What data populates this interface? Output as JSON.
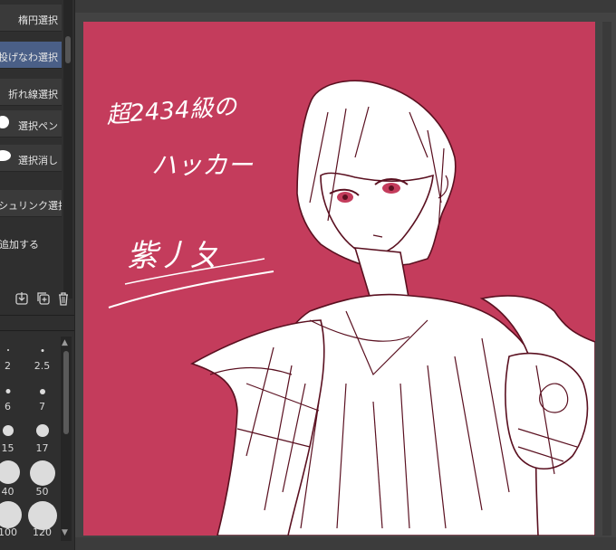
{
  "tools": [
    {
      "label": "楕円選択",
      "active": false
    },
    {
      "label": "投げなわ選択",
      "active": true
    },
    {
      "label": "折れ線選択",
      "active": false
    },
    {
      "label": "選択ペン",
      "active": false
    },
    {
      "label": "選択消し",
      "active": false
    },
    {
      "label": "シュリンク選択",
      "active": false
    },
    {
      "label": "追加する",
      "active": false
    }
  ],
  "panel_icons": [
    "import-icon",
    "add-subtool-icon",
    "trash-icon"
  ],
  "brush_sizes": [
    "2",
    "2.5",
    "6",
    "7",
    "15",
    "17",
    "40",
    "50",
    "100",
    "120"
  ],
  "canvas": {
    "background": "#c43c5c",
    "handwriting_line1": "超2434級の",
    "handwriting_line2": "ハッカー",
    "signature": "紫丿ㄆ"
  },
  "colors": {
    "panel_bg": "#2f2f2f",
    "active_tool": "#4a5f87",
    "canvas_surround": "#434343"
  }
}
